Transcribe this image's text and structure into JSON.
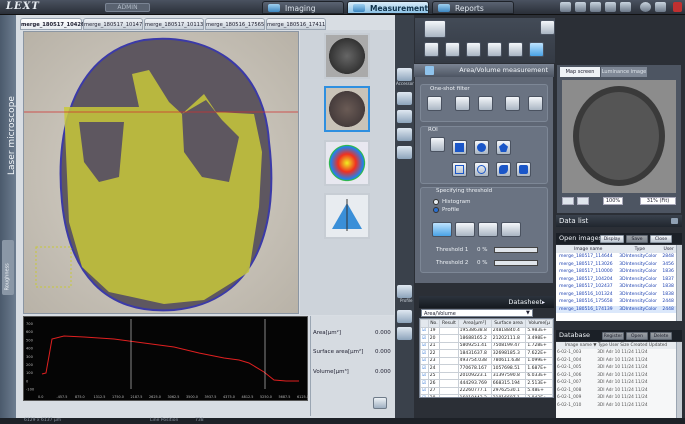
{
  "app": {
    "logo": "LEXT",
    "user_badge": "ADMIN"
  },
  "top_tabs": [
    {
      "label": "Imaging"
    },
    {
      "label": "Measurement"
    },
    {
      "label": "Reports"
    }
  ],
  "left": {
    "vertical_title": "Laser microscope",
    "side_tab": "Roughness",
    "image_tabs": [
      "merge_180517_10426",
      "merge_180517_10147",
      "merge_180517_10113",
      "merge_180516_17565",
      "merge_180516_17411"
    ]
  },
  "profile": {
    "x_ticks": [
      "0.0",
      "-457.5",
      "875.0",
      "1312.5",
      "1750.0",
      "2187.5",
      "2625.0",
      "3062.5",
      "3500.0",
      "3937.5",
      "4375.0",
      "4812.5",
      "5250.0",
      "5687.5",
      "6125.0"
    ],
    "y_ticks": [
      "700",
      "600",
      "500",
      "400",
      "300",
      "200",
      "100",
      "0",
      "-100"
    ],
    "stats": [
      {
        "label": "Area[µm²]",
        "value": "0.000"
      },
      {
        "label": "Surface area[µm²]",
        "value": "0.000"
      },
      {
        "label": "Volume[µm³]",
        "value": "0.000"
      }
    ]
  },
  "tools": {
    "accessory": "Accessory",
    "profile": "Profile"
  },
  "area_panel": {
    "title": "Area/Volume measurement",
    "one_shot": "One-shot filter",
    "roi": "ROI",
    "threshold_title": "Specifying threshold",
    "radio_histogram": "Histogram",
    "radio_profile": "Profile",
    "threshold1": "Threshold 1",
    "threshold2": "Threshold 2",
    "th_val": "0 %"
  },
  "viewer": {
    "tab1": "Map screen",
    "tab2": "Luminance image",
    "zoom": "100%",
    "fit": "31% (Fit)"
  },
  "datasheet": {
    "title": "Datasheet",
    "select": "Area/Volume",
    "columns": [
      "",
      "No.",
      "Result",
      "Area[µm²]",
      "Surface area",
      "Volume[µ"
    ],
    "rows": [
      [
        "☑",
        "19",
        "",
        "19538638.8",
        "24818840.4",
        "5.983E+"
      ],
      [
        "☑",
        "20",
        "",
        "18688165.2",
        "21202111.8",
        "3.498E+"
      ],
      [
        "☑",
        "21",
        "",
        "5809251.41",
        "7508199.47",
        "1.728E+"
      ],
      [
        "☑",
        "22",
        "",
        "18431637.8",
        "32698185.3",
        "7.622E+"
      ],
      [
        "☑",
        "23",
        "",
        "493754.038",
        "780611.638",
        "1.099E+"
      ],
      [
        "☑",
        "24",
        "",
        "770678.167",
        "1057698.51",
        "1.687E+"
      ],
      [
        "☑",
        "25",
        "",
        "20109223.1",
        "31397590.8",
        "6.033E+"
      ],
      [
        "☑",
        "26",
        "",
        "444293.769",
        "668315.194",
        "2.513E+"
      ],
      [
        "☑",
        "27",
        "",
        "22260777.1",
        "29762530.1",
        "5.48E+"
      ],
      [
        "☑",
        "28",
        "",
        "16018443.2",
        "21816687.1",
        "3.843E+"
      ]
    ]
  },
  "data_list": {
    "title": "Data list",
    "open_images": "Open images",
    "btn_display": "Display",
    "btn_save": "Save",
    "btn_close": "Close",
    "columns": [
      "",
      "Image name",
      "Type",
      "User"
    ],
    "rows": [
      [
        "",
        "merge_180517_114644",
        "3DIntensityColor",
        "2848"
      ],
      [
        "",
        "merge_180517_113026",
        "3DIntensityColor",
        "3456"
      ],
      [
        "",
        "merge_180517_110000",
        "3DIntensityColor",
        "1836"
      ],
      [
        "",
        "merge_180517_104204",
        "3DIntensityColor",
        "1837"
      ],
      [
        "",
        "merge_180517_102437",
        "3DIntensityColor",
        "1838"
      ],
      [
        "",
        "merge_180516_101324",
        "3DIntensityColor",
        "1838"
      ],
      [
        "",
        "merge_180516_175658",
        "3DIntensityColor",
        "2448"
      ],
      [
        "",
        "merge_180516_174139",
        "3DIntensityColor",
        "2448"
      ]
    ]
  },
  "database": {
    "title": "Database",
    "btn_register": "Register",
    "btn_open": "Open",
    "btn_delete": "Delete",
    "columns": "Image name  ▼ Type  User  Size  Created  Updated",
    "rows": [
      [
        "6-02-1_003",
        "3DI  Adr  10  11/24  11/24"
      ],
      [
        "6-02-1_004",
        "3DI  Adr  10  11/24  11/24"
      ],
      [
        "6-02-1_005",
        "3DI  Adr  10  11/24  11/24"
      ],
      [
        "6-02-1_006",
        "3DI  Adr  10  11/24  11/24"
      ],
      [
        "6-02-1_007",
        "3DI  Adr  10  11/24  11/24"
      ],
      [
        "6-02-1_008",
        "3DI  Adr  10  11/24  11/24"
      ],
      [
        "6-02-1_009",
        "3DI  Adr  10  11/24  11/24"
      ],
      [
        "6-02-1_010",
        "3DI  Adr  10  11/24  11/24"
      ]
    ]
  },
  "statusbar": {
    "left": "6129 x 6137 µm",
    "mid": "Line Position",
    "value": "738"
  }
}
